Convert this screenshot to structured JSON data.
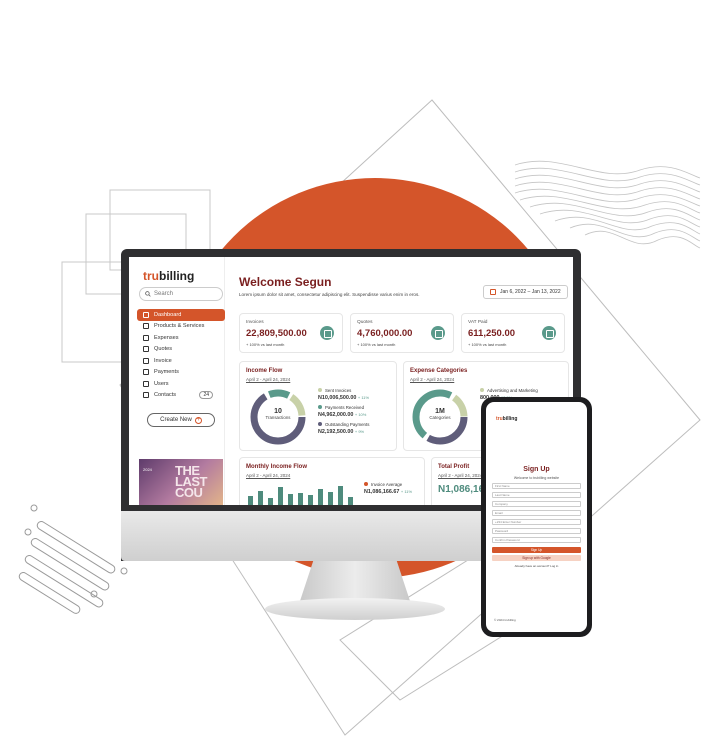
{
  "colors": {
    "accent": "#d4552a",
    "title": "#7a1f1f",
    "teal": "#5a9a8b",
    "slate": "#5f5d7a",
    "sage": "#c8d1a8"
  },
  "app": {
    "logo_prefix": "tru",
    "logo_suffix": "billing",
    "search_placeholder": "Search",
    "nav": [
      {
        "label": "Dashboard",
        "icon": "dashboard-icon"
      },
      {
        "label": "Products & Services",
        "icon": "box-icon"
      },
      {
        "label": "Expenses",
        "icon": "expense-icon"
      },
      {
        "label": "Quotes",
        "icon": "quote-icon"
      },
      {
        "label": "Invoice",
        "icon": "invoice-icon"
      },
      {
        "label": "Payments",
        "icon": "chart-icon"
      },
      {
        "label": "Users",
        "icon": "users-icon"
      },
      {
        "label": "Contacts",
        "icon": "contacts-icon",
        "badge": "24"
      }
    ],
    "create_new": "Create New",
    "promo_small": "2024",
    "promo_text": "THE LAST COU"
  },
  "header": {
    "welcome": "Welcome Segun",
    "subtitle": "Lorem ipsum dolor sit amet, consectetur adipiscing elit. Suspendisse varius enim in eros.",
    "date_range": "Jan 6, 2022 – Jan 13, 2022"
  },
  "cards": [
    {
      "label": "Invoices",
      "value": "22,809,500.00",
      "change": "+ 100% vs last month"
    },
    {
      "label": "Quotes",
      "value": "4,760,000.00",
      "change": "+ 100% vs last month"
    },
    {
      "label": "VAT Paid",
      "value": "611,250.00",
      "change": "+ 100% vs last month"
    }
  ],
  "income_flow": {
    "title": "Income Flow",
    "range": "April 2 - April 24, 2024",
    "center_value": "10",
    "center_label": "Transactions",
    "legend": [
      {
        "label": "Sent Invoices",
        "amount": "N10,006,500.00",
        "delta": "+ 11%"
      },
      {
        "label": "Payments Received",
        "amount": "N4,962,000.00",
        "delta": "+ 10%"
      },
      {
        "label": "Outstanding Payments",
        "amount": "N2,192,500.00",
        "delta": "+ 9%"
      }
    ]
  },
  "expense_categories": {
    "title": "Expense Categories",
    "range": "April 2 - April 24, 2024",
    "center_value": "1M",
    "center_label": "Categories",
    "legend": [
      {
        "label": "Advertising and Marketing",
        "amount": "800,000",
        "delta": "13.5%"
      }
    ]
  },
  "monthly_income": {
    "title": "Monthly Income Flow",
    "range": "April 2 - April 24, 2024",
    "legend_label": "Invoice Average",
    "legend_amount": "N1,086,166.67",
    "legend_delta": "+ 11%",
    "bars": [
      0.45,
      0.7,
      0.35,
      0.85,
      0.55,
      0.6,
      0.5,
      0.75,
      0.65,
      0.9,
      0.4
    ]
  },
  "total_profit": {
    "title": "Total Profit",
    "range": "April 2 - April 24, 2024",
    "value": "N1,086,166"
  },
  "phone": {
    "logo_prefix": "tru",
    "logo_suffix": "billing",
    "title": "Sign Up",
    "subtitle": "Welcome to trubilling website",
    "fields": [
      "First Name",
      "Last Name",
      "Company",
      "Email",
      "+234  Enter Number",
      "Password",
      "Confirm Password"
    ],
    "signup_label": "Sign Up",
    "google_label": "Sign up with Google",
    "note": "Already have an account? Log in",
    "footer": "© 2024 trubilling"
  }
}
